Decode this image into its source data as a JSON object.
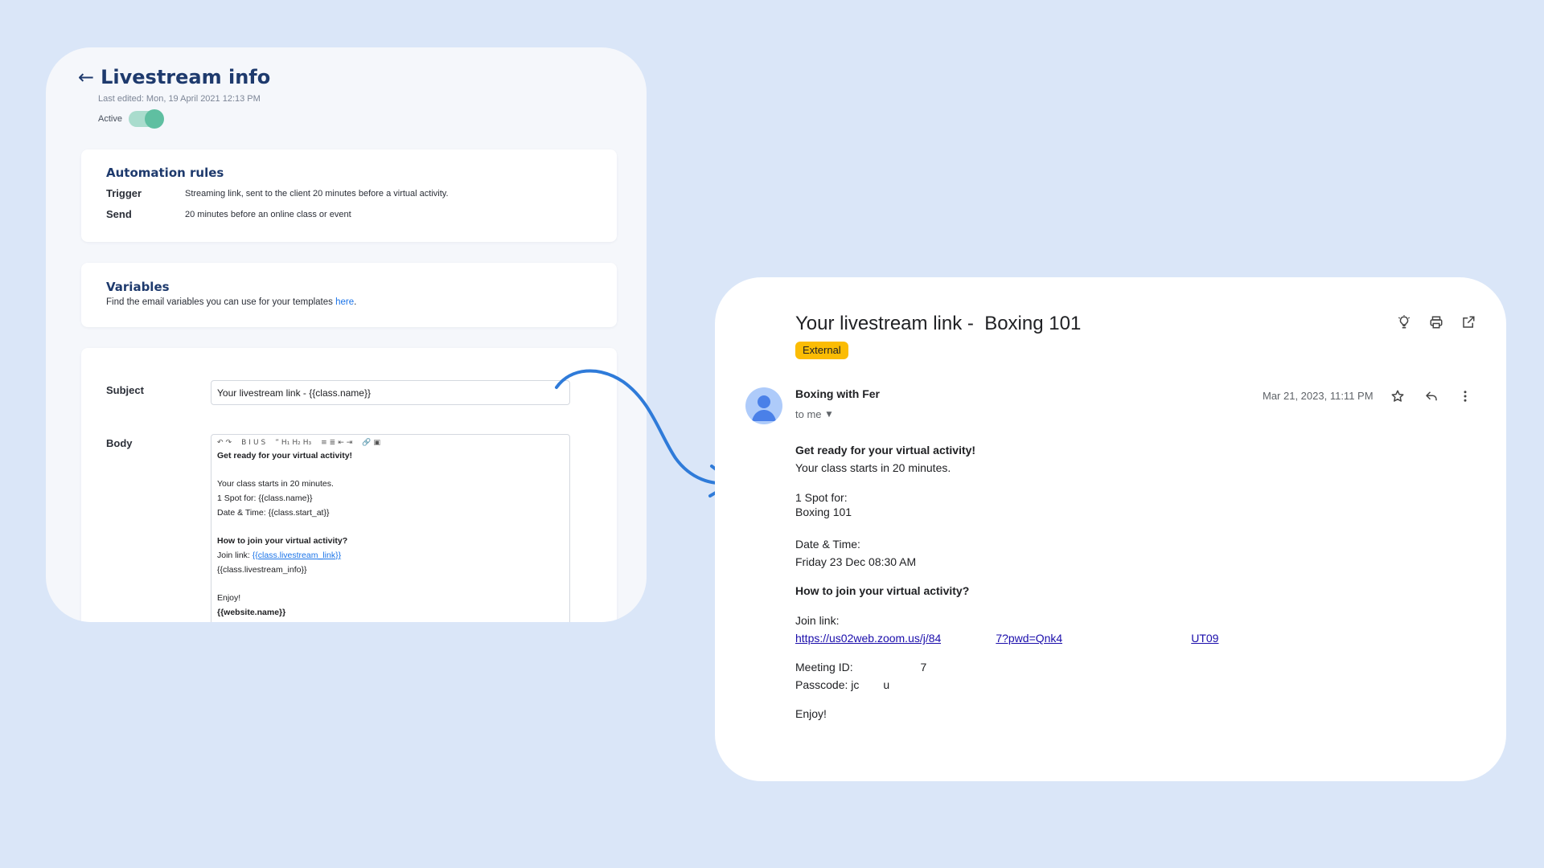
{
  "colors": {
    "background": "#dae6f8",
    "brand_navy": "#1e3a6d",
    "toggle_on": "#5fbfa1",
    "link_blue": "#1a73e8",
    "badge_yellow": "#fbbc04",
    "arrow_blue": "#2f7bd9"
  },
  "livestream": {
    "back_icon": "arrow-left-icon",
    "title": "Livestream info",
    "last_edited": "Last edited: Mon, 19 April 2021 12:13 PM",
    "active_label": "Active",
    "active": true
  },
  "automation": {
    "title": "Automation rules",
    "trigger_label": "Trigger",
    "trigger_value": "Streaming link, sent to the client 20 minutes before a virtual activity.",
    "send_label": "Send",
    "send_value": "20 minutes before an online class or event"
  },
  "variables": {
    "title": "Variables",
    "description": "Find the email variables you can use for your templates",
    "link_text": "here",
    "suffix": "."
  },
  "template": {
    "subject_label": "Subject",
    "subject_value": "Your livestream link - {{class.name}}",
    "body_label": "Body",
    "toolbar": [
      "↶",
      "↷",
      "B",
      "I",
      "U",
      "S",
      "”",
      "H₁",
      "H₂",
      "H₃",
      "≡",
      "≣",
      "⇤",
      "⇥",
      "🔗",
      "▣"
    ],
    "body": {
      "heading": "Get ready for your virtual activity!",
      "line1": "Your class starts in 20 minutes.",
      "line2": "1 Spot for: {{class.name}}",
      "line3": "Date & Time: {{class.start_at}}",
      "join_heading": "How to join your virtual activity?",
      "join_label": "Join link: ",
      "join_link": "{{class.livestream_link}}",
      "info": "{{class.livestream_info}}",
      "enjoy": "Enjoy!",
      "website": "{{website.name}}"
    }
  },
  "email": {
    "subject": "Your livestream link -  Boxing 101",
    "badge": "External",
    "sender": "Boxing with Fer",
    "recipient": "to me",
    "date": "Mar 21, 2023, 11:11 PM",
    "heading": "Get ready for your virtual activity!",
    "starts": "Your class starts in 20 minutes.",
    "spot_label": "1 Spot for:",
    "spot_value": "Boxing 101",
    "datetime_label": "Date & Time:",
    "datetime_value": "Friday 23 Dec 08:30 AM",
    "join_heading": "How to join your virtual activity?",
    "join_label": "Join link:",
    "join_link_part1": "https://us02web.zoom.us/j/84",
    "join_link_part2": "7?pwd=Qnk4",
    "join_link_part3": "UT09",
    "meeting_id_label": "Meeting ID: ",
    "meeting_id_tail": "7",
    "passcode_label": "Passcode: jc",
    "passcode_tail": "u",
    "enjoy": "Enjoy!",
    "icons": {
      "top": [
        "lightbulb-icon",
        "print-icon",
        "open-in-new-icon"
      ],
      "row": [
        "star-icon",
        "reply-icon",
        "more-vert-icon"
      ]
    }
  }
}
